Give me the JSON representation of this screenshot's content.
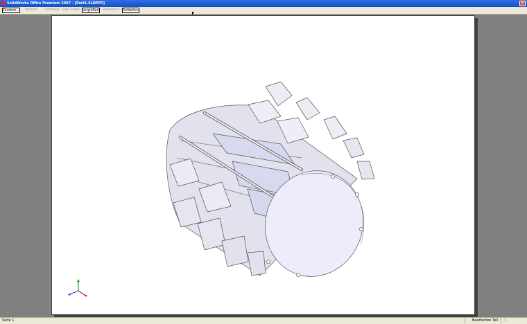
{
  "window": {
    "title": "SolidWorks Office Premium 2007 - [Part1.SLDPRT]"
  },
  "toolbar": {
    "buttons": [
      {
        "label": "Drucken...",
        "enabled": true
      },
      {
        "label": "Nächste",
        "enabled": false
      },
      {
        "label": "Vorherige",
        "enabled": false
      },
      {
        "label": "Zwei Seiten",
        "enabled": false
      },
      {
        "label": "Vergrößern",
        "enabled": true
      },
      {
        "label": "Verkleinern",
        "enabled": false
      },
      {
        "label": "Schließen",
        "enabled": true
      }
    ]
  },
  "statusbar": {
    "page": "Seite 1",
    "mode": "Bearbeiten Teil"
  },
  "colors": {
    "part_face": "#e8e8f2",
    "part_light": "#d6d6ec",
    "part_shadow": "#c2c2d6",
    "triad_x": "#d02020",
    "triad_y": "#20a020",
    "triad_z": "#2040d0"
  }
}
